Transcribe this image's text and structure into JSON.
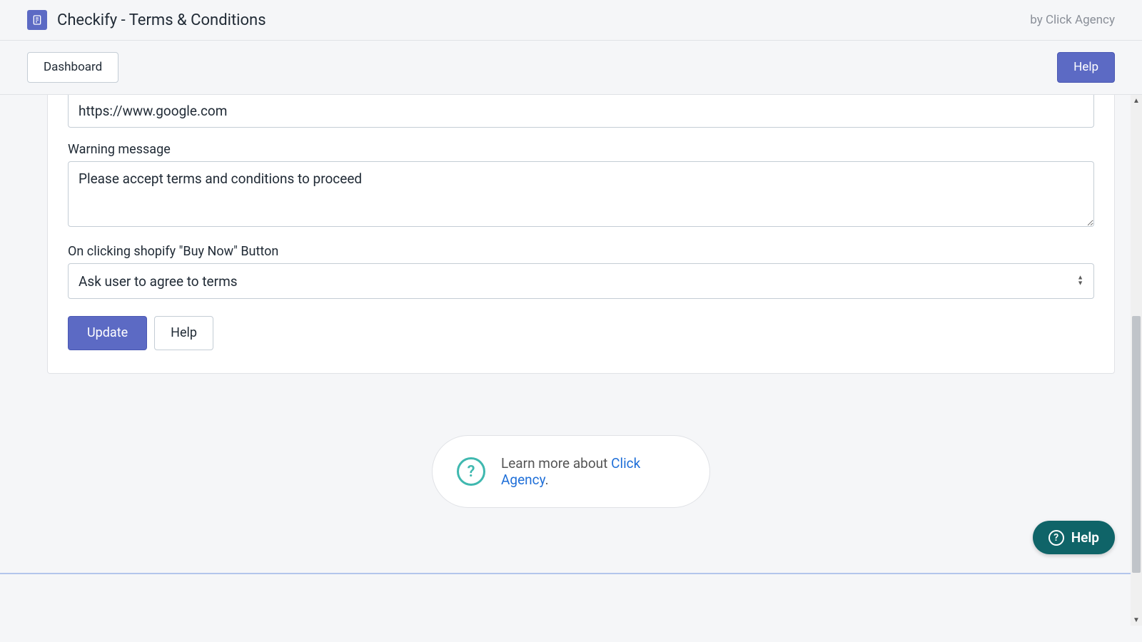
{
  "header": {
    "app_title": "Checkify - Terms & Conditions",
    "vendor_prefix": "by Click Agency"
  },
  "actionbar": {
    "dashboard_label": "Dashboard",
    "help_label": "Help"
  },
  "form": {
    "url_value": "https://www.google.com",
    "warning_label": "Warning message",
    "warning_value": "Please accept terms and conditions to proceed",
    "buynow_label": "On clicking shopify \"Buy Now\" Button",
    "buynow_selected": "Ask user to agree to terms",
    "update_label": "Update",
    "help_label": "Help"
  },
  "footer": {
    "learn_prefix": "Learn more about ",
    "learn_link": "Click Agency",
    "learn_suffix": "."
  },
  "float_help_label": "Help"
}
